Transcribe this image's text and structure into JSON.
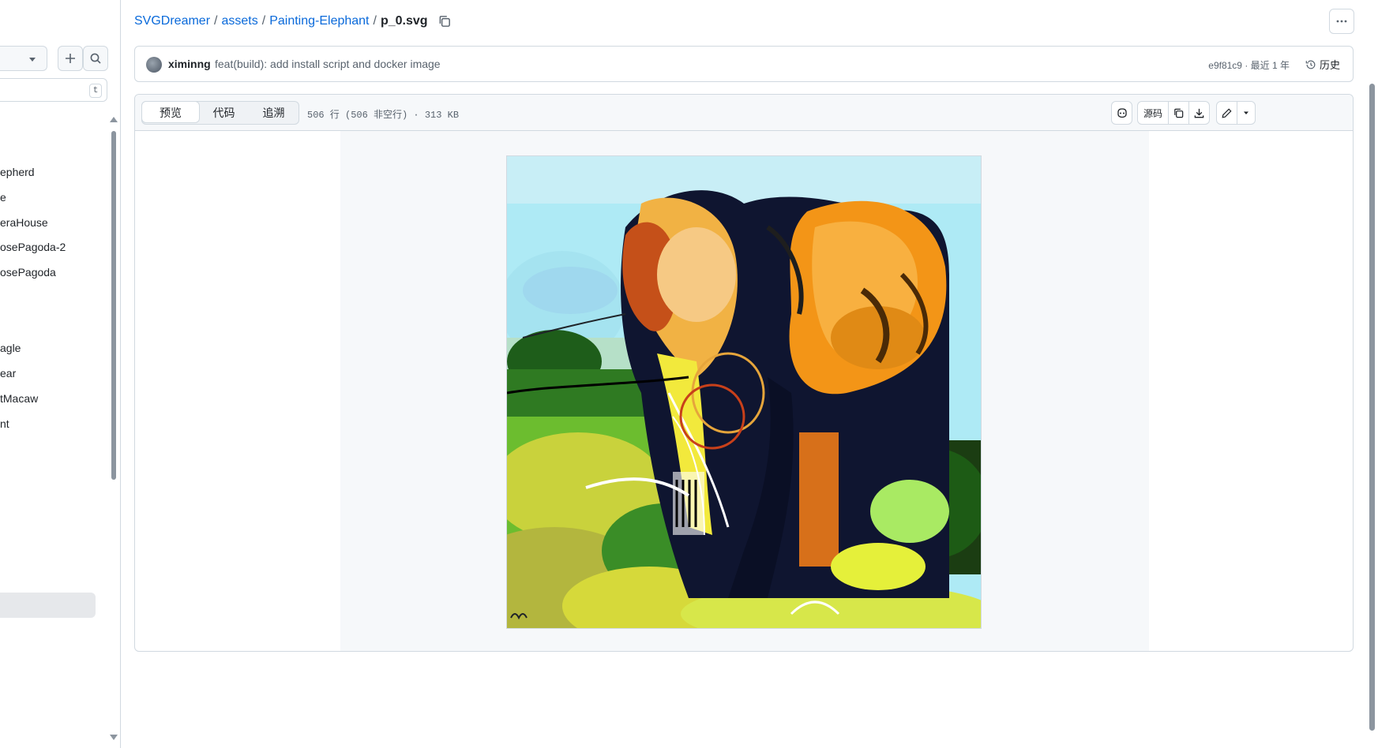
{
  "sidebar": {
    "filter_shortcut": "t",
    "items": [
      {
        "label": "epherd"
      },
      {
        "label": "e"
      },
      {
        "label": "eraHouse"
      },
      {
        "label": "osePagoda-2"
      },
      {
        "label": "osePagoda"
      },
      {
        "label": "agle"
      },
      {
        "label": "ear"
      },
      {
        "label": "tMacaw"
      },
      {
        "label": "nt"
      }
    ]
  },
  "breadcrumb": {
    "repo": "SVGDreamer",
    "folder1": "assets",
    "folder2": "Painting-Elephant",
    "file": "p_0.svg",
    "separator": "/"
  },
  "commit": {
    "author": "ximinng",
    "message": "feat(build): add install script and docker image",
    "sha": "e9f81c9",
    "time": "· 最近 1 年",
    "history_label": "历史"
  },
  "viewer": {
    "tabs": [
      {
        "label": "预览",
        "active": true
      },
      {
        "label": "代码",
        "active": false
      },
      {
        "label": "追溯",
        "active": false
      }
    ],
    "file_info": "506 行 (506 非空行) · 313 KB",
    "raw_label": "源码"
  },
  "icons": {
    "copy": "copy-icon",
    "more": "kebab-horizontal-icon",
    "history": "history-icon",
    "copilot": "copilot-icon",
    "download": "download-icon",
    "edit": "pencil-icon",
    "dropdown": "triangle-down-icon",
    "add": "plus-icon",
    "search": "search-icon"
  },
  "colors": {
    "link": "#0969da",
    "border": "#d1d9e0",
    "muted": "#59636e"
  }
}
